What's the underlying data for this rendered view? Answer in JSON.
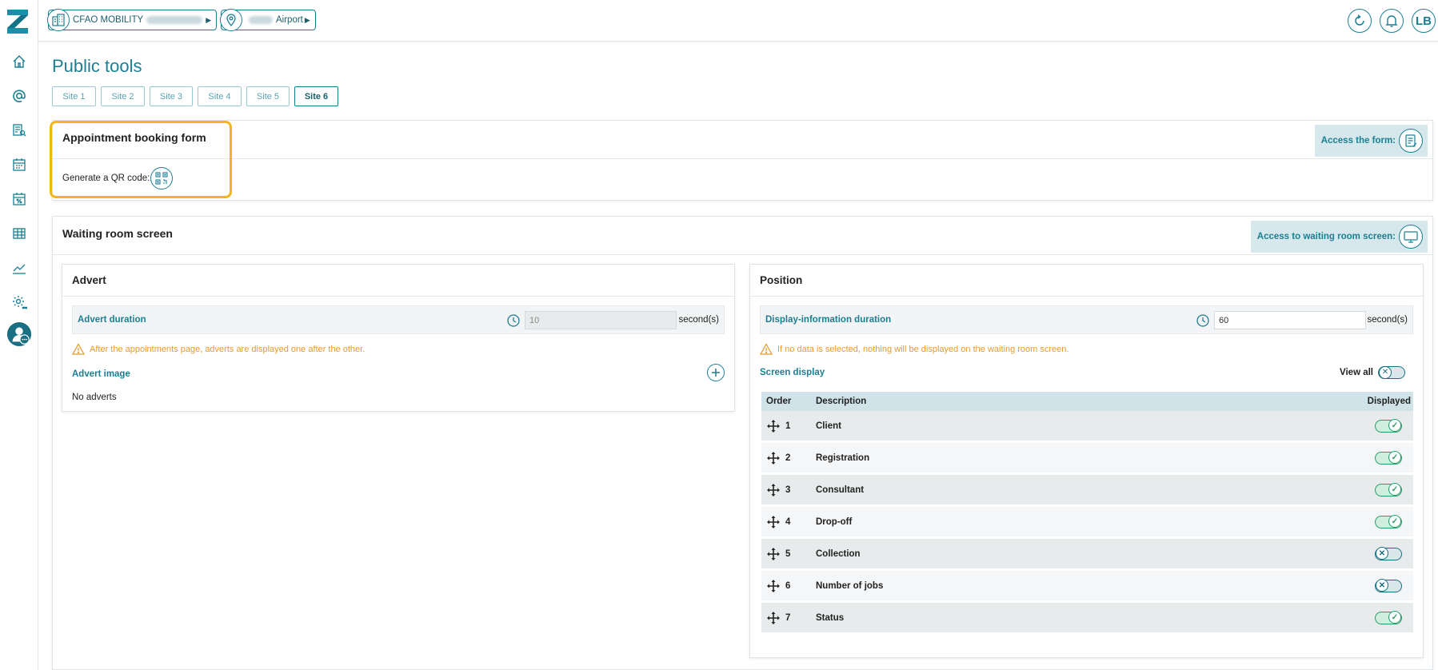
{
  "topbar": {
    "company_label": "CFAO MOBILITY",
    "location_label": "Airport",
    "user_initials": "LB"
  },
  "page": {
    "title": "Public tools"
  },
  "site_tabs": [
    "Site 1",
    "Site 2",
    "Site 3",
    "Site 4",
    "Site 5",
    "Site 6"
  ],
  "active_site_tab": "Site 6",
  "booking": {
    "title": "Appointment booking form",
    "qr_label": "Generate a QR code:",
    "access_label": "Access the form:"
  },
  "waiting_room": {
    "title": "Waiting room screen",
    "access_label": "Access to waiting room screen:",
    "advert": {
      "title": "Advert",
      "duration_label": "Advert duration",
      "duration_value": "10",
      "unit": "second(s)",
      "warning": "After the appointments page, adverts are displayed one after the other.",
      "image_label": "Advert image",
      "empty_text": "No adverts"
    },
    "position": {
      "title": "Position",
      "duration_label": "Display-information duration",
      "duration_value": "60",
      "unit": "second(s)",
      "warning": "If no data is selected, nothing will be displayed on the waiting room screen.",
      "screen_display_label": "Screen display",
      "view_all_label": "View all",
      "view_all_on": false,
      "columns": {
        "order": "Order",
        "description": "Description",
        "displayed": "Displayed"
      },
      "rows": [
        {
          "order": "1",
          "description": "Client",
          "displayed": true
        },
        {
          "order": "2",
          "description": "Registration",
          "displayed": true
        },
        {
          "order": "3",
          "description": "Consultant",
          "displayed": true
        },
        {
          "order": "4",
          "description": "Drop-off",
          "displayed": true
        },
        {
          "order": "5",
          "description": "Collection",
          "displayed": false
        },
        {
          "order": "6",
          "description": "Number of jobs",
          "displayed": false
        },
        {
          "order": "7",
          "description": "Status",
          "displayed": true
        }
      ]
    }
  },
  "colors": {
    "accent": "#1b7f93",
    "highlight": "#f3b51c",
    "toggle_on": "#2a9e6a",
    "warning": "#e89a2a"
  },
  "icons": [
    "home-icon",
    "at-icon",
    "list-search-icon",
    "calendar-icon",
    "calendar-percent-icon",
    "table-icon",
    "chart-line-icon",
    "settings-icon",
    "profile-icon"
  ]
}
